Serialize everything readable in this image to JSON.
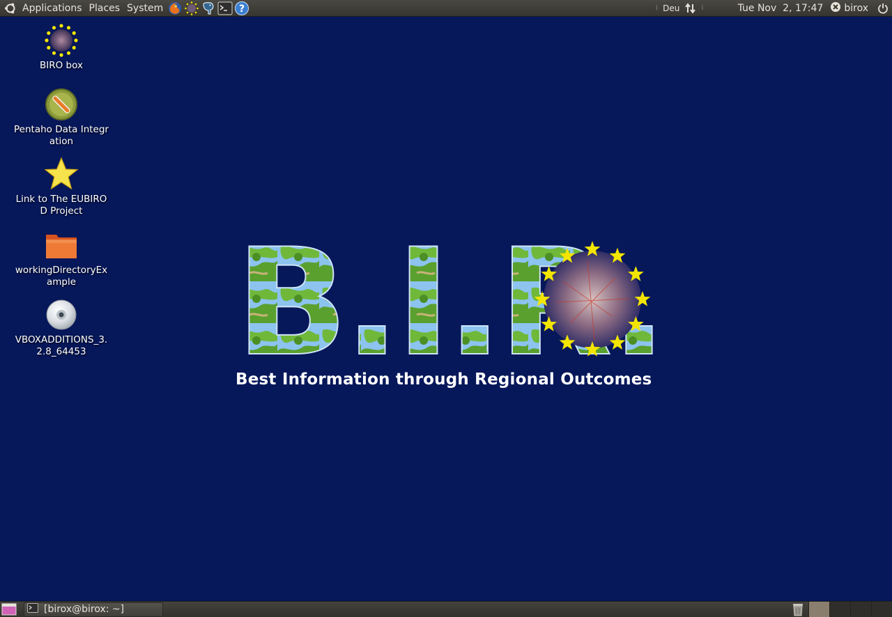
{
  "top_panel": {
    "menus": [
      "Applications",
      "Places",
      "System"
    ],
    "keyboard_layout": "Deu",
    "clock": "Tue Nov  2, 17:47",
    "user": "birox"
  },
  "desktop_icons": [
    {
      "label": "BIRO box"
    },
    {
      "label": "Pentaho Data Integration"
    },
    {
      "label": "Link to The EUBIROD Project"
    },
    {
      "label": "workingDirectoryExample"
    },
    {
      "label": "VBOXADDITIONS_3.2.8_64453"
    }
  ],
  "wallpaper": {
    "title": "B.I.R.",
    "tagline": "Best Information through Regional Outcomes"
  },
  "bottom_panel": {
    "task_label": "[birox@birox: ~]"
  },
  "colors": {
    "desktop": "#06175a",
    "panel": "#3c3b37",
    "star": "#f3e500",
    "letter_fill": "#7fb7e8",
    "letter_land": "#4f9a2a"
  }
}
